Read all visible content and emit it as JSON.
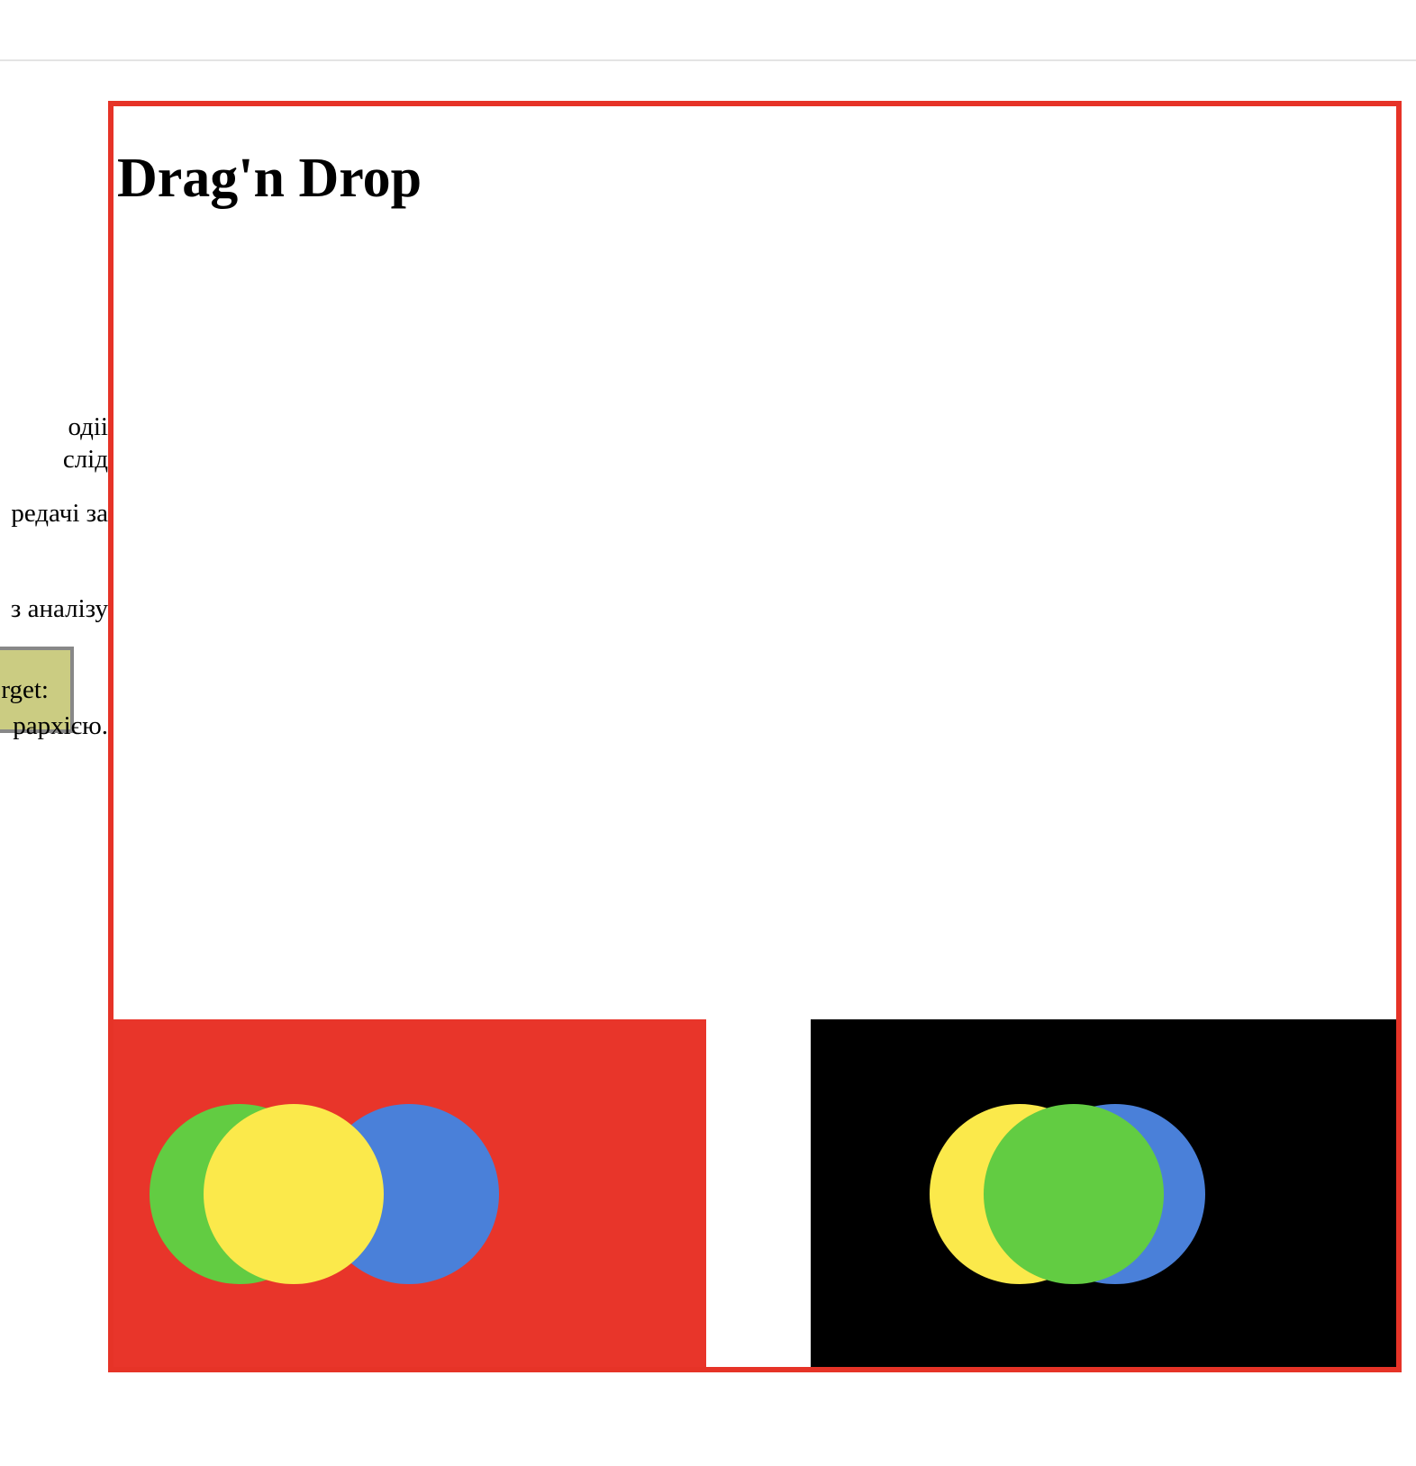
{
  "left_panel": {
    "lines": [
      "одіі",
      "слід",
      "редачі за",
      "з аналізу",
      "рархією."
    ],
    "target_label": "rget:"
  },
  "demo": {
    "title": "Drag'n Drop"
  },
  "zones": [
    {
      "name": "red-drop-zone",
      "color": "#e8352a",
      "circles": [
        {
          "color": "#4a80d9",
          "name": "blue-circle"
        },
        {
          "color": "#62cc42",
          "name": "green-circle"
        },
        {
          "color": "#fbe94b",
          "name": "yellow-circle"
        }
      ]
    },
    {
      "name": "black-drop-zone",
      "color": "#000000",
      "circles": [
        {
          "color": "#4a80d9",
          "name": "blue-circle"
        },
        {
          "color": "#fbe94b",
          "name": "yellow-circle"
        },
        {
          "color": "#62cc42",
          "name": "green-circle"
        }
      ]
    }
  ],
  "colors": {
    "frame_border": "#e63327",
    "target_bg": "#cbcc82"
  }
}
